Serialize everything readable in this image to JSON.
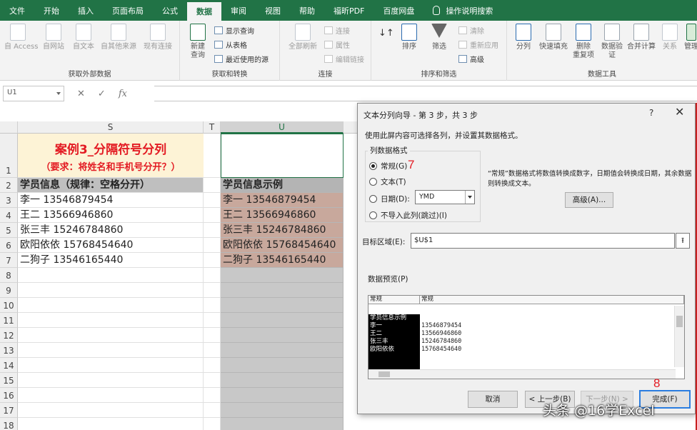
{
  "tabs": [
    "文件",
    "开始",
    "插入",
    "页面布局",
    "公式",
    "数据",
    "审阅",
    "视图",
    "帮助",
    "福昕PDF",
    "百度网盘",
    "操作说明搜索"
  ],
  "ribbon": {
    "group1": {
      "label": "获取外部数据",
      "buttons": [
        "自 Access",
        "自网站",
        "自文本",
        "自其他来源",
        "现有连接"
      ]
    },
    "group2": {
      "label": "获取和转换",
      "big_button": "新建\n查询",
      "small": [
        "显示查询",
        "从表格",
        "最近使用的源"
      ]
    },
    "group3": {
      "label": "连接",
      "big_button": "全部刷新",
      "small": [
        "连接",
        "属性",
        "编辑链接"
      ]
    },
    "group4": {
      "label": "排序和筛选",
      "buttons": [
        "排序",
        "筛选"
      ],
      "small": [
        "清除",
        "重新应用",
        "高级"
      ]
    },
    "group5": {
      "label": "数据工具",
      "buttons": [
        "分列",
        "快速填充",
        "删除\n重复项",
        "数据验\n证",
        "合并计算",
        "关系",
        "管理"
      ]
    }
  },
  "formula_bar": {
    "name_box": "U1",
    "icons": [
      "✕",
      "✓",
      "fx"
    ]
  },
  "sheet": {
    "columns": [
      "S",
      "T",
      "U"
    ],
    "rows": [
      "1",
      "2",
      "3",
      "4",
      "5",
      "6",
      "7",
      "8",
      "9",
      "10",
      "11",
      "12",
      "13",
      "14",
      "15",
      "16",
      "17",
      "18"
    ],
    "title_line1": "案例3_分隔符号分列",
    "title_line2": "（要求：将姓名和手机号分开？）",
    "s_header": "学员信息（规律：空格分开）",
    "u_header": "学员信息示例",
    "s_values": [
      "李一 13546879454",
      "王二 13566946860",
      "张三丰 15246784860",
      "欧阳依依 15768454640",
      "二狗子 13546165440"
    ],
    "u_values": [
      "李一 13546879454",
      "王二 13566946860",
      "张三丰 15246784860",
      "欧阳依依 15768454640",
      "二狗子 13546165440"
    ]
  },
  "dialog": {
    "title": "文本分列向导 - 第 3 步，共 3 步",
    "help": "?",
    "close": "✕",
    "description": "使用此屏内容可选择各列，并设置其数据格式。",
    "format_legend": "列数据格式",
    "radios": [
      {
        "label": "常规(G)",
        "checked": true
      },
      {
        "label": "文本(T)",
        "checked": false
      },
      {
        "label": "日期(D):",
        "checked": false
      },
      {
        "label": "不导入此列(跳过)(I)",
        "checked": false
      }
    ],
    "date_format": "YMD",
    "note": "“常规”数据格式将数值转换成数字，日期值会转换成日期，其余数据则转换成文本。",
    "advanced_button": "高级(A)...",
    "destination_label": "目标区域(E):",
    "destination_value": "$U$1",
    "destination_btn": "⭱",
    "preview_label": "数据预览(P)",
    "preview_headers": [
      "常规",
      "常规"
    ],
    "preview_col1": [
      "学员信息示例",
      "李一",
      "王二",
      "张三丰",
      "欧阳依依"
    ],
    "preview_col2": [
      "",
      "13546879454",
      "13566946860",
      "15246784860",
      "15768454640"
    ],
    "buttons": {
      "cancel": "取消",
      "back": "< 上一步(B)",
      "next": "下一步(N) >",
      "finish": "完成(F)"
    }
  },
  "annotations": [
    "7",
    "8"
  ],
  "watermark": "头条 @16学Excel"
}
